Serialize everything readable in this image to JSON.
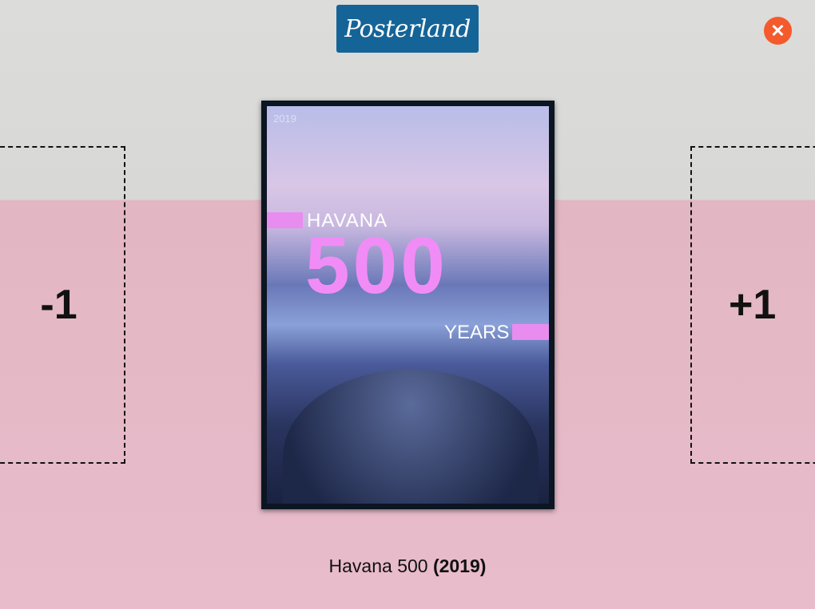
{
  "header": {
    "logo": "Posterland",
    "close_icon": "close-icon",
    "close_color": "#f45a2c",
    "logo_bg": "#156497"
  },
  "vote": {
    "down_label": "-1",
    "up_label": "+1"
  },
  "poster": {
    "year": "2019",
    "line1": "HAVANA",
    "number": "500",
    "line2": "YEARS"
  },
  "caption": {
    "title": "Havana 500",
    "year": "(2019)"
  }
}
